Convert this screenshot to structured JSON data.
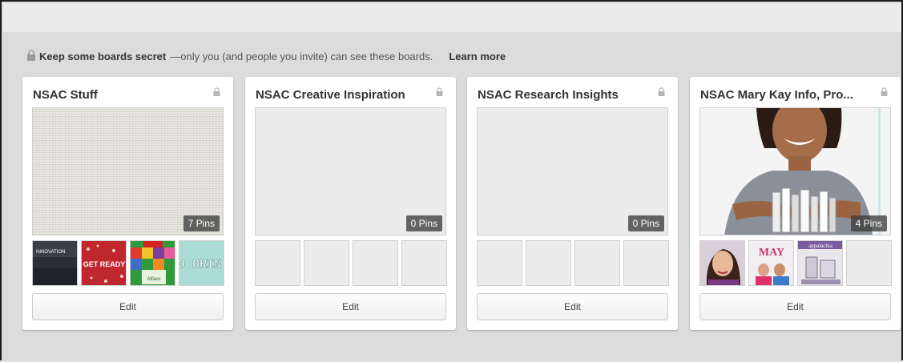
{
  "notice": {
    "bold": "Keep some boards secret",
    "text": "—only you (and people you invite) can see these boards.",
    "link": "Learn more"
  },
  "boards": [
    {
      "title": "NSAC Stuff",
      "pins": "7 Pins",
      "edit": "Edit",
      "thumbs": [
        "INNOVATION",
        "GET READY",
        "Alfaxo",
        "O DRIN"
      ]
    },
    {
      "title": "NSAC Creative Inspiration",
      "pins": "0 Pins",
      "edit": "Edit"
    },
    {
      "title": "NSAC Research Insights",
      "pins": "0 Pins",
      "edit": "Edit"
    },
    {
      "title": "NSAC Mary Kay Info, Pro...",
      "pins": "4 Pins",
      "edit": "Edit",
      "thumbs": [
        "",
        "MAY",
        "appalachia",
        ""
      ]
    }
  ],
  "icons": {
    "lock": "lock-icon"
  }
}
